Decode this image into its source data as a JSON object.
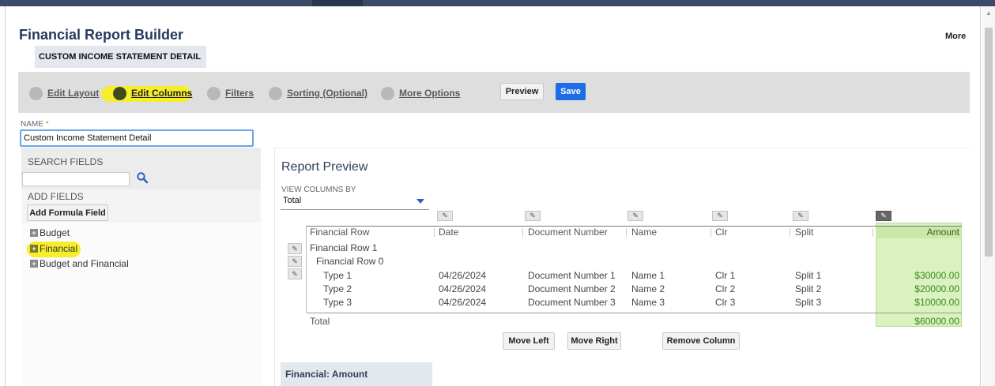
{
  "app": {
    "title": "Financial Report Builder",
    "more": "More",
    "subtitle": "CUSTOM INCOME STATEMENT DETAIL"
  },
  "steps": [
    {
      "label": "Edit Layout",
      "active": false
    },
    {
      "label": "Edit Columns",
      "active": true
    },
    {
      "label": "Filters",
      "active": false
    },
    {
      "label": "Sorting (Optional)",
      "active": false
    },
    {
      "label": "More Options",
      "active": false
    }
  ],
  "actions": {
    "preview": "Preview",
    "save": "Save"
  },
  "name_field": {
    "label": "NAME",
    "required_mark": "*",
    "value": "Custom Income Statement Detail"
  },
  "left_panel": {
    "search_label": "SEARCH FIELDS",
    "search_placeholder": "",
    "add_fields_label": "ADD FIELDS",
    "add_formula_button": "Add Formula Field",
    "tree": [
      {
        "label": "Budget",
        "highlighted": false
      },
      {
        "label": "Financial",
        "highlighted": true
      },
      {
        "label": "Budget and Financial",
        "highlighted": false
      }
    ]
  },
  "preview": {
    "title": "Report Preview",
    "view_columns_label": "VIEW COLUMNS BY",
    "view_columns_value": "Total",
    "columns": [
      "Financial Row",
      "Date",
      "Document Number",
      "Name",
      "Clr",
      "Split",
      "Amount"
    ],
    "group_rows": [
      "Financial Row 1",
      "Financial Row 0"
    ],
    "rows": [
      {
        "label": "Type 1",
        "date": "04/26/2024",
        "doc": "Document Number 1",
        "name": "Name 1",
        "clr": "Clr 1",
        "split": "Split 1",
        "amount": "$30000.00"
      },
      {
        "label": "Type 2",
        "date": "04/26/2024",
        "doc": "Document Number 2",
        "name": "Name 2",
        "clr": "Clr 2",
        "split": "Split 2",
        "amount": "$20000.00"
      },
      {
        "label": "Type 3",
        "date": "04/26/2024",
        "doc": "Document Number 3",
        "name": "Name 3",
        "clr": "Clr 3",
        "split": "Split 3",
        "amount": "$10000.00"
      }
    ],
    "total_label": "Total",
    "total_amount": "$60000.00",
    "buttons": {
      "move_left": "Move Left",
      "move_right": "Move Right",
      "remove_column": "Remove Column"
    },
    "selected_field_title": "Financial: Amount"
  },
  "colors": {
    "accent": "#1d6ee6",
    "highlight": "#f6ee2a",
    "amount_bg": "#d9f2bf",
    "title": "#253a5e"
  }
}
